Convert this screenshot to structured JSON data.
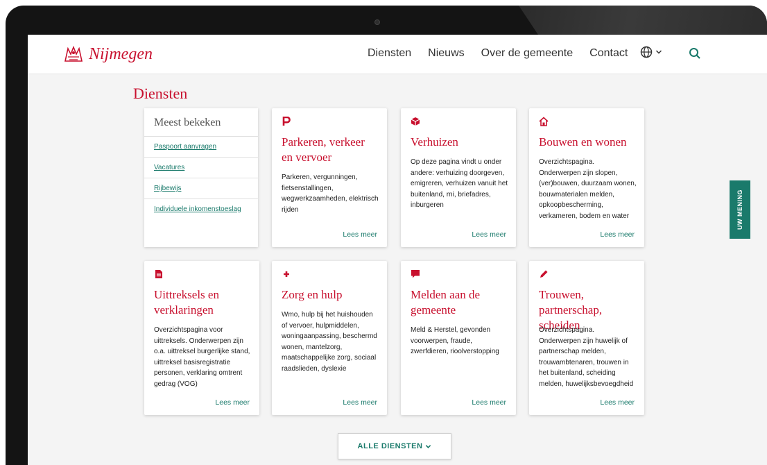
{
  "site": {
    "name": "Nijmegen"
  },
  "nav": {
    "items": [
      "Diensten",
      "Nieuws",
      "Over de gemeente",
      "Contact"
    ]
  },
  "page": {
    "title": "Diensten"
  },
  "popular": {
    "title": "Meest bekeken",
    "links": [
      "Paspoort aanvragen",
      "Vacatures",
      "Rijbewijs",
      "Individuele inkomenstoeslag"
    ]
  },
  "cards": [
    {
      "icon": "parking-icon",
      "title": "Parkeren, verkeer en vervoer",
      "text": "Parkeren, vergunningen, fietsenstallingen, wegwerkzaamheden, elektrisch rijden",
      "more": "Lees meer"
    },
    {
      "icon": "box-icon",
      "title": "Verhuizen",
      "text": "Op deze pagina vindt u onder andere: verhuizing doorgeven, emigreren, verhuizen vanuit het buitenland, rni, briefadres, inburgeren",
      "more": "Lees meer"
    },
    {
      "icon": "home-icon",
      "title": "Bouwen en wonen",
      "text": "Overzichtspagina. Onderwerpen zijn slopen, (ver)bouwen, duurzaam wonen, bouwmaterialen melden, opkoopbescherming, verkameren, bodem en water",
      "more": "Lees meer"
    },
    {
      "icon": "document-icon",
      "title": "Uittreksels en verklaringen",
      "text": "Overzichtspagina voor uittreksels. Onderwerpen zijn o.a. uittreksel burgerlijke stand, uittreksel basisregistratie personen, verklaring omtrent gedrag (VOG)",
      "more": "Lees meer"
    },
    {
      "icon": "plus-icon",
      "title": "Zorg en hulp",
      "text": "Wmo, hulp bij het huishouden of vervoer, hulpmiddelen, woningaanpassing, beschermd wonen, mantelzorg, maatschappelijke zorg, sociaal raadslieden, dyslexie",
      "more": "Lees meer"
    },
    {
      "icon": "chat-icon",
      "title": "Melden aan de gemeente",
      "text": "Meld & Herstel, gevonden voorwerpen, fraude, zwerfdieren, rioolverstopping",
      "more": "Lees meer"
    },
    {
      "icon": "pen-icon",
      "title": "Trouwen, partnerschap, scheiden",
      "text": "Overzichtspagina. Onderwerpen zijn huwelijk of partnerschap melden, trouwambtenaren, trouwen in het buitenland, scheiding melden, huwelijksbevoegdheid",
      "more": "Lees meer"
    }
  ],
  "all_services_button": "ALLE DIENSTEN",
  "feedback_tab": "UW MENING",
  "colors": {
    "brand": "#c8102e",
    "accent": "#1a7a6b"
  }
}
